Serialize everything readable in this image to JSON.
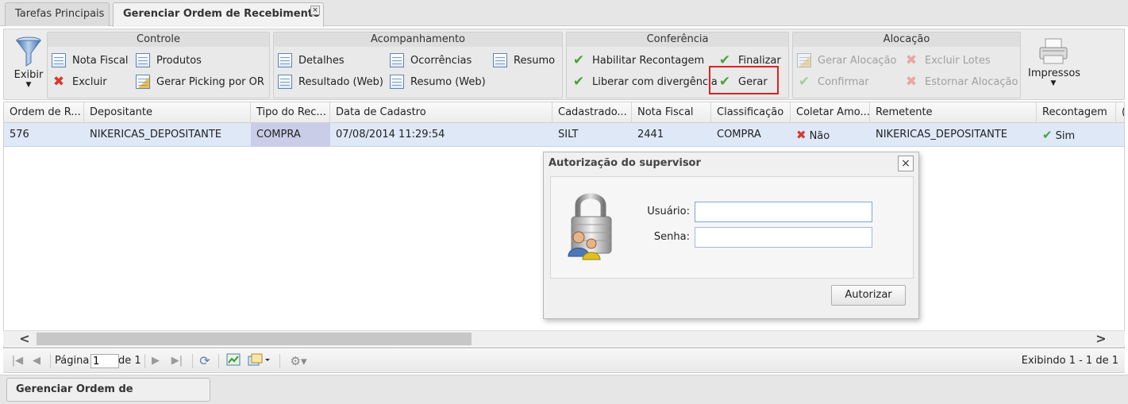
{
  "tabs": [
    {
      "label": "Tarefas Principais"
    },
    {
      "label": "Gerenciar Ordem de Recebimento",
      "close": "×"
    }
  ],
  "toolbar": {
    "exibir": "Exibir",
    "impressos": "Impressos",
    "groups": {
      "controle": {
        "title": "Controle",
        "nota_fiscal": "Nota Fiscal",
        "produtos": "Produtos",
        "excluir": "Excluir",
        "gerar_picking": "Gerar Picking por OR"
      },
      "acompanhamento": {
        "title": "Acompanhamento",
        "detalhes": "Detalhes",
        "ocorrencias": "Ocorrências",
        "resumo": "Resumo",
        "resultado_web": "Resultado (Web)",
        "resumo_web": "Resumo (Web)"
      },
      "conferencia": {
        "title": "Conferência",
        "habilitar": "Habilitar Recontagem",
        "finalizar": "Finalizar",
        "liberar": "Liberar com divergência",
        "gerar": "Gerar"
      },
      "alocacao": {
        "title": "Alocação",
        "gerar_alocacao": "Gerar Alocação",
        "excluir_lotes": "Excluir Lotes",
        "confirmar": "Confirmar",
        "estornar": "Estornar Alocação"
      }
    }
  },
  "grid": {
    "columns": [
      "Ordem de R...",
      "Depositante",
      "Tipo do Rec...",
      "Data de Cadastro",
      "Cadastrado...",
      "Nota Fiscal",
      "Classificação",
      "Coletar Amo...",
      "Remetente",
      "Recontagem",
      "("
    ],
    "row": {
      "ordem": "576",
      "depositante": "NIKERICAS_DEPOSITANTE",
      "tipo": "COMPRA",
      "data": "07/08/2014 11:29:54",
      "cadastrado": "SILT",
      "nota": "2441",
      "classificacao": "COMPRA",
      "coletar": "Não",
      "remetente": "NIKERICAS_DEPOSITANTE",
      "recontagem": "Sim"
    },
    "scroll_left": "<",
    "scroll_right": ">"
  },
  "pager": {
    "pagina": "Página",
    "page_value": "1",
    "de": "de 1",
    "info": "Exibindo 1 - 1 de 1"
  },
  "bottom_tab": "Gerenciar Ordem de Recebimento",
  "modal": {
    "title": "Autorização do supervisor",
    "close": "×",
    "usuario_label": "Usuário:",
    "senha_label": "Senha:",
    "usuario_value": "",
    "senha_value": "",
    "button": "Autorizar"
  },
  "colors": {
    "selected_row": "#dfe8f6",
    "highlight": "#e02020",
    "check": "#4aa33a",
    "cross": "#d23b2f"
  }
}
